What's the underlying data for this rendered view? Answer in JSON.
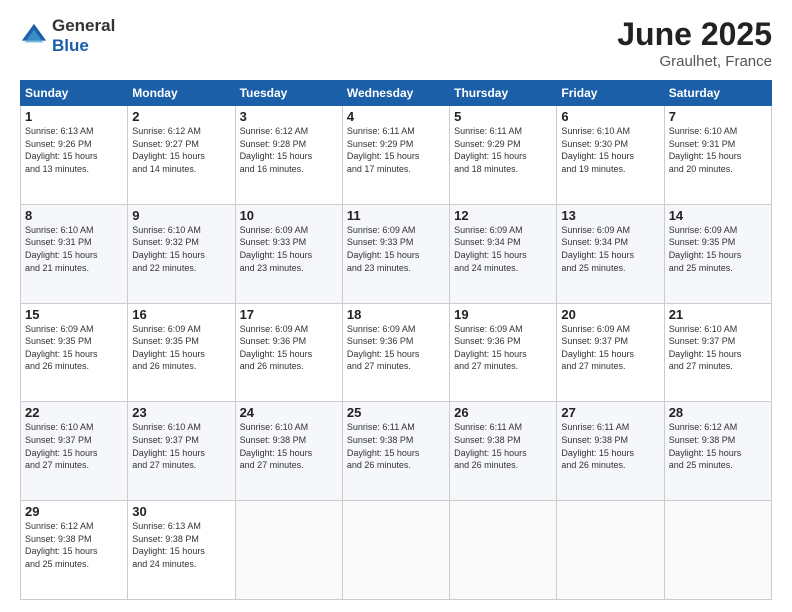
{
  "logo": {
    "general": "General",
    "blue": "Blue"
  },
  "header": {
    "month": "June 2025",
    "location": "Graulhet, France"
  },
  "days": [
    "Sunday",
    "Monday",
    "Tuesday",
    "Wednesday",
    "Thursday",
    "Friday",
    "Saturday"
  ],
  "weeks": [
    [
      {
        "day": "1",
        "sunrise": "6:13 AM",
        "sunset": "9:26 PM",
        "daylight": "15 hours and 13 minutes."
      },
      {
        "day": "2",
        "sunrise": "6:12 AM",
        "sunset": "9:27 PM",
        "daylight": "15 hours and 14 minutes."
      },
      {
        "day": "3",
        "sunrise": "6:12 AM",
        "sunset": "9:28 PM",
        "daylight": "15 hours and 16 minutes."
      },
      {
        "day": "4",
        "sunrise": "6:11 AM",
        "sunset": "9:29 PM",
        "daylight": "15 hours and 17 minutes."
      },
      {
        "day": "5",
        "sunrise": "6:11 AM",
        "sunset": "9:29 PM",
        "daylight": "15 hours and 18 minutes."
      },
      {
        "day": "6",
        "sunrise": "6:10 AM",
        "sunset": "9:30 PM",
        "daylight": "15 hours and 19 minutes."
      },
      {
        "day": "7",
        "sunrise": "6:10 AM",
        "sunset": "9:31 PM",
        "daylight": "15 hours and 20 minutes."
      }
    ],
    [
      {
        "day": "8",
        "sunrise": "6:10 AM",
        "sunset": "9:31 PM",
        "daylight": "15 hours and 21 minutes."
      },
      {
        "day": "9",
        "sunrise": "6:10 AM",
        "sunset": "9:32 PM",
        "daylight": "15 hours and 22 minutes."
      },
      {
        "day": "10",
        "sunrise": "6:09 AM",
        "sunset": "9:33 PM",
        "daylight": "15 hours and 23 minutes."
      },
      {
        "day": "11",
        "sunrise": "6:09 AM",
        "sunset": "9:33 PM",
        "daylight": "15 hours and 23 minutes."
      },
      {
        "day": "12",
        "sunrise": "6:09 AM",
        "sunset": "9:34 PM",
        "daylight": "15 hours and 24 minutes."
      },
      {
        "day": "13",
        "sunrise": "6:09 AM",
        "sunset": "9:34 PM",
        "daylight": "15 hours and 25 minutes."
      },
      {
        "day": "14",
        "sunrise": "6:09 AM",
        "sunset": "9:35 PM",
        "daylight": "15 hours and 25 minutes."
      }
    ],
    [
      {
        "day": "15",
        "sunrise": "6:09 AM",
        "sunset": "9:35 PM",
        "daylight": "15 hours and 26 minutes."
      },
      {
        "day": "16",
        "sunrise": "6:09 AM",
        "sunset": "9:35 PM",
        "daylight": "15 hours and 26 minutes."
      },
      {
        "day": "17",
        "sunrise": "6:09 AM",
        "sunset": "9:36 PM",
        "daylight": "15 hours and 26 minutes."
      },
      {
        "day": "18",
        "sunrise": "6:09 AM",
        "sunset": "9:36 PM",
        "daylight": "15 hours and 27 minutes."
      },
      {
        "day": "19",
        "sunrise": "6:09 AM",
        "sunset": "9:36 PM",
        "daylight": "15 hours and 27 minutes."
      },
      {
        "day": "20",
        "sunrise": "6:09 AM",
        "sunset": "9:37 PM",
        "daylight": "15 hours and 27 minutes."
      },
      {
        "day": "21",
        "sunrise": "6:10 AM",
        "sunset": "9:37 PM",
        "daylight": "15 hours and 27 minutes."
      }
    ],
    [
      {
        "day": "22",
        "sunrise": "6:10 AM",
        "sunset": "9:37 PM",
        "daylight": "15 hours and 27 minutes."
      },
      {
        "day": "23",
        "sunrise": "6:10 AM",
        "sunset": "9:37 PM",
        "daylight": "15 hours and 27 minutes."
      },
      {
        "day": "24",
        "sunrise": "6:10 AM",
        "sunset": "9:38 PM",
        "daylight": "15 hours and 27 minutes."
      },
      {
        "day": "25",
        "sunrise": "6:11 AM",
        "sunset": "9:38 PM",
        "daylight": "15 hours and 26 minutes."
      },
      {
        "day": "26",
        "sunrise": "6:11 AM",
        "sunset": "9:38 PM",
        "daylight": "15 hours and 26 minutes."
      },
      {
        "day": "27",
        "sunrise": "6:11 AM",
        "sunset": "9:38 PM",
        "daylight": "15 hours and 26 minutes."
      },
      {
        "day": "28",
        "sunrise": "6:12 AM",
        "sunset": "9:38 PM",
        "daylight": "15 hours and 25 minutes."
      }
    ],
    [
      {
        "day": "29",
        "sunrise": "6:12 AM",
        "sunset": "9:38 PM",
        "daylight": "15 hours and 25 minutes."
      },
      {
        "day": "30",
        "sunrise": "6:13 AM",
        "sunset": "9:38 PM",
        "daylight": "15 hours and 24 minutes."
      },
      null,
      null,
      null,
      null,
      null
    ]
  ],
  "labels": {
    "sunrise": "Sunrise:",
    "sunset": "Sunset:",
    "daylight": "Daylight:"
  }
}
